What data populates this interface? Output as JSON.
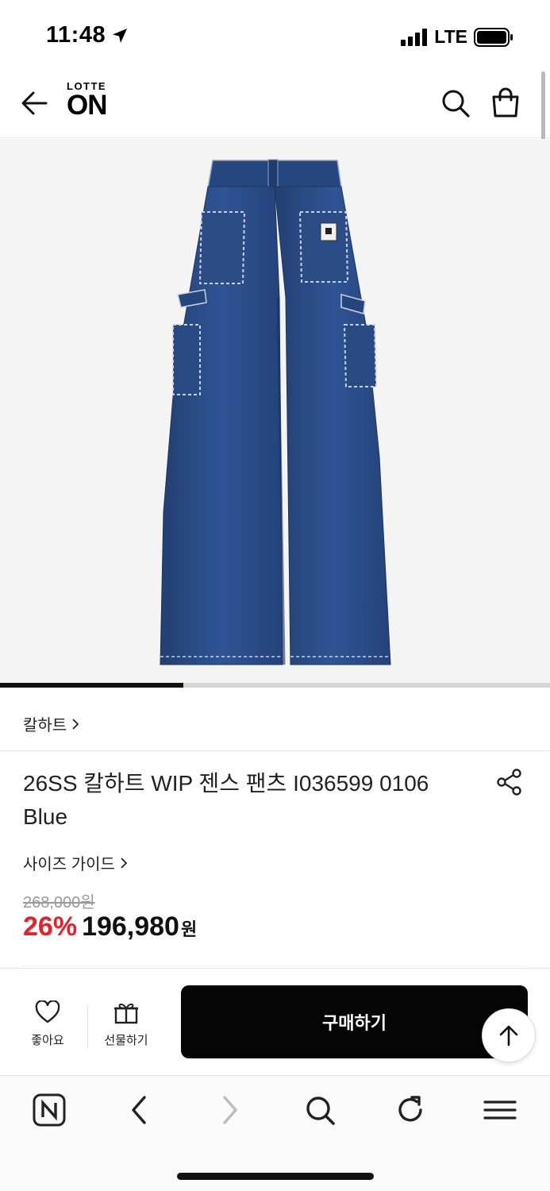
{
  "status_bar": {
    "time": "11:48",
    "network": "LTE"
  },
  "header": {
    "logo_top": "LOTTE",
    "logo_main": "ON"
  },
  "product": {
    "brand": "칼하트",
    "title": "26SS 칼하트 WIP 젠스 팬츠 I036599 0106 Blue",
    "size_guide": "사이즈 가이드",
    "original_price": "268,000원",
    "discount": "26%",
    "sale_price": "196,980",
    "currency": "원",
    "image_progress": 0.333
  },
  "bottom_bar": {
    "like_label": "좋아요",
    "gift_label": "선물하기",
    "buy_label": "구매하기"
  },
  "icons": {
    "back": "arrow-left-icon",
    "search": "search-icon",
    "cart": "shopping-bag-icon",
    "share": "share-icon",
    "like": "heart-icon",
    "gift": "gift-icon",
    "top": "arrow-up-icon",
    "browser": [
      "naver-icon",
      "chevron-left-icon",
      "chevron-right-icon",
      "search-icon",
      "refresh-icon",
      "menu-icon"
    ]
  },
  "colors": {
    "discount": "#e8202a",
    "buy_button": "#050505",
    "denim": "#2c4f8c"
  }
}
